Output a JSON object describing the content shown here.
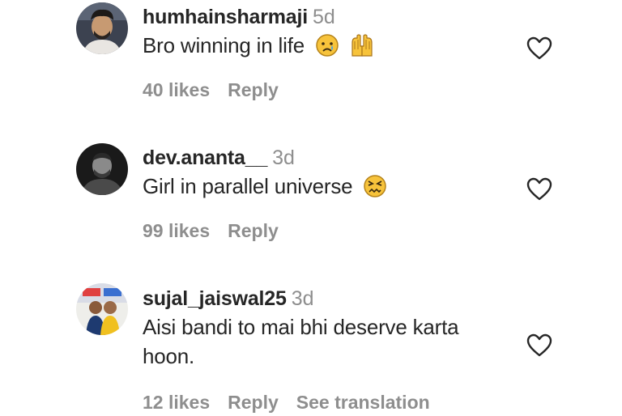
{
  "comments": [
    {
      "username": "humhainsharmaji",
      "time": "5d",
      "text": "Bro winning in life",
      "emojis": [
        "sad-tear-emoji",
        "raising-hands-emoji"
      ],
      "likes": "40 likes",
      "reply": "Reply"
    },
    {
      "username": "dev.ananta__",
      "time": "3d",
      "text": "Girl in parallel universe",
      "emojis": [
        "confounded-face-emoji"
      ],
      "likes": "99 likes",
      "reply": "Reply"
    },
    {
      "username": "sujal_jaiswal25",
      "time": "3d",
      "text_line1": "Aisi bandi to mai bhi deserve karta",
      "text_line2": "hoon.",
      "likes": "12 likes",
      "reply": "Reply",
      "see_translation": "See translation"
    }
  ],
  "icons": {
    "like": "heart-outline-icon"
  },
  "colors": {
    "text": "#262626",
    "secondary": "#8e8e8e",
    "emoji_yellow": "#f7c33b"
  }
}
